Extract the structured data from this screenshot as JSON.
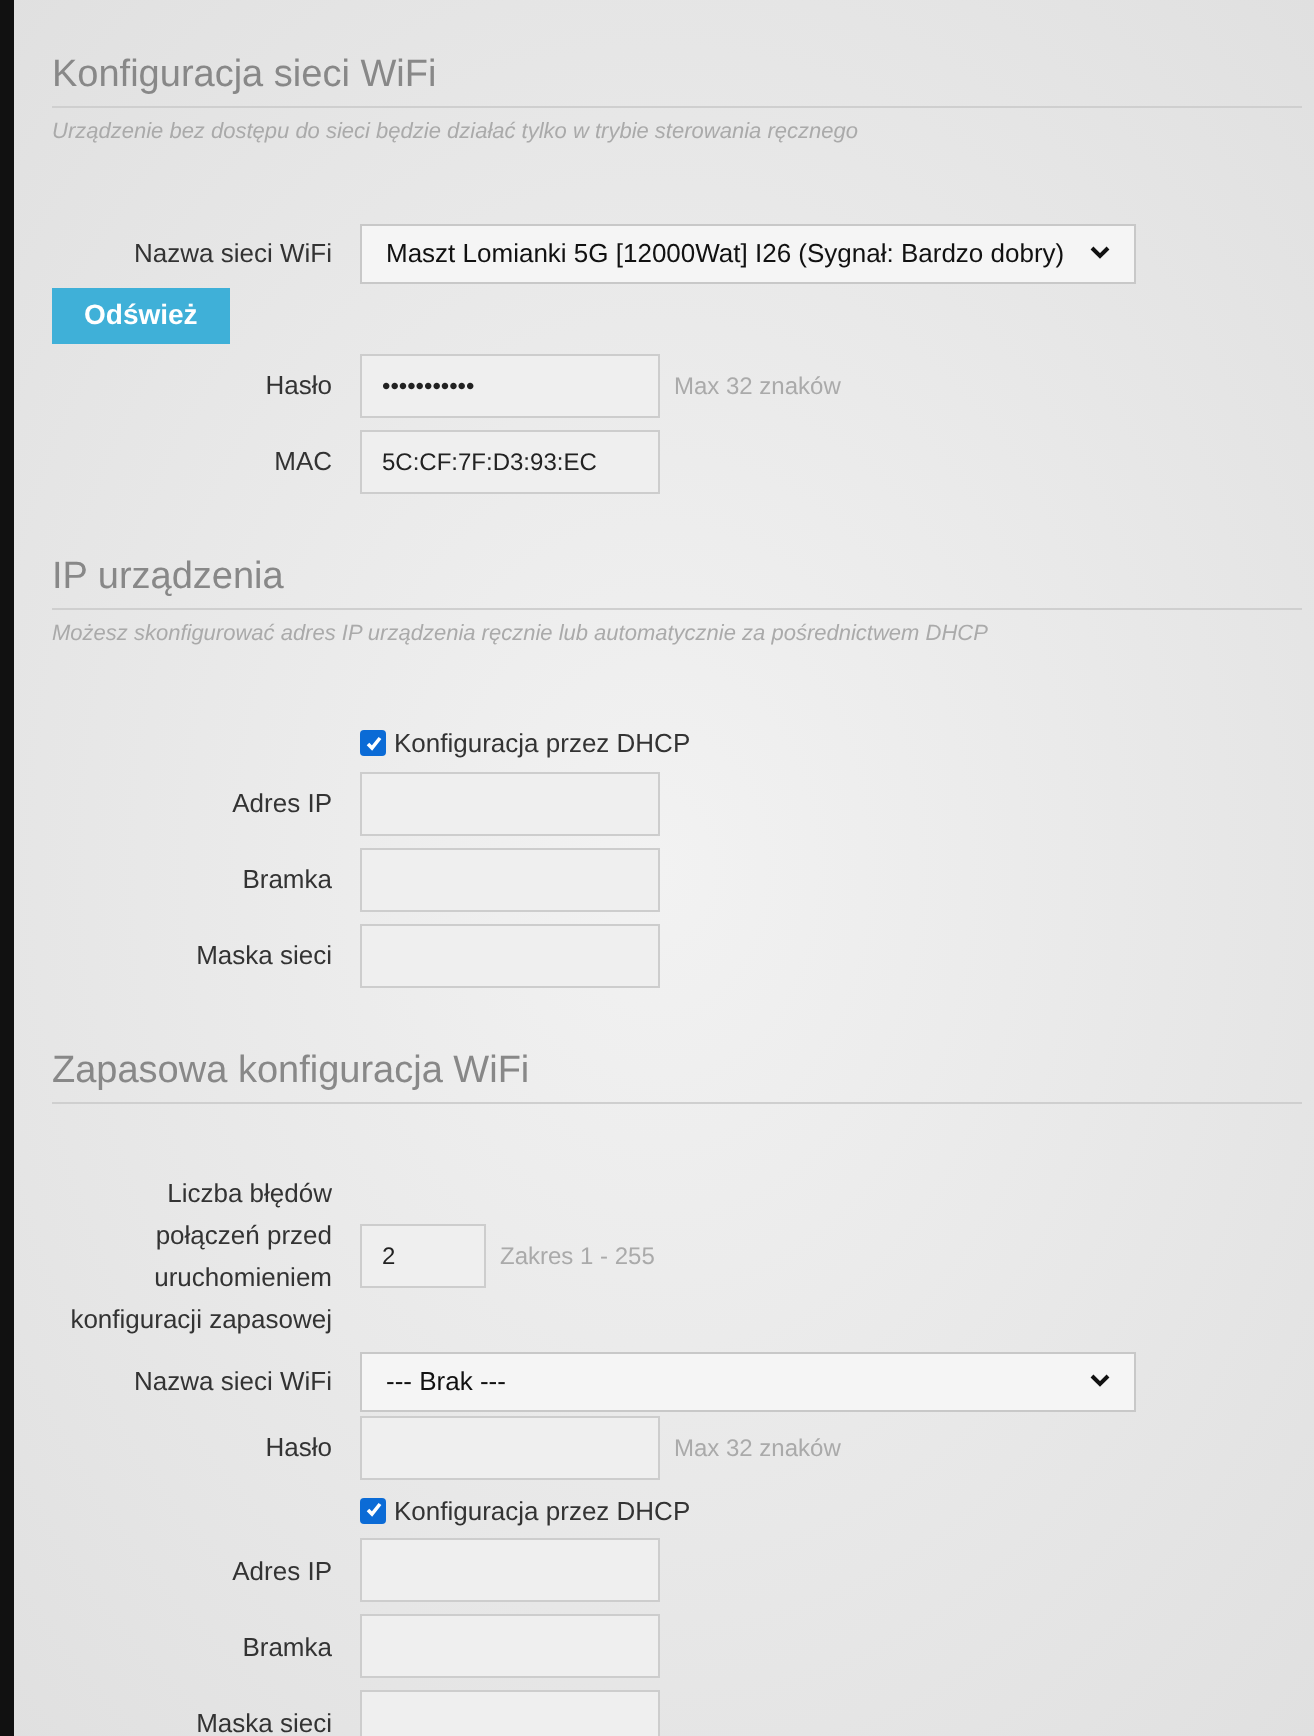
{
  "sections": [
    {
      "title": "Konfiguracja sieci WiFi",
      "subtitle": "Urządzenie bez dostępu do sieci będzie działać tylko w trybie sterowania ręcznego",
      "rows": [
        {
          "kind": "select",
          "label": "Nazwa sieci WiFi",
          "value": "Maszt Lomianki 5G [12000Wat] I26 (Sygnał: Bardzo dobry)"
        },
        {
          "kind": "button",
          "label": "Odśwież"
        },
        {
          "kind": "input",
          "label": "Hasło",
          "value": "•••••••••••",
          "hint": "Max 32 znaków"
        },
        {
          "kind": "input",
          "label": "MAC",
          "value": "5C:CF:7F:D3:93:EC"
        }
      ]
    },
    {
      "title": "IP urządzenia",
      "subtitle": "Możesz skonfigurować adres IP urządzenia ręcznie lub automatycznie za pośrednictwem DHCP",
      "rows": [
        {
          "kind": "checkbox",
          "label": "Konfiguracja przez DHCP",
          "checked": true
        },
        {
          "kind": "input",
          "label": "Adres IP"
        },
        {
          "kind": "input",
          "label": "Bramka"
        },
        {
          "kind": "input",
          "label": "Maska sieci"
        }
      ]
    },
    {
      "title": "Zapasowa konfiguracja WiFi",
      "rows": [
        {
          "kind": "number",
          "label": "Liczba błędów połączeń przed uruchomieniem konfiguracji zapasowej",
          "value": "2",
          "hint": "Zakres 1 - 255"
        },
        {
          "kind": "select",
          "label": "Nazwa sieci WiFi",
          "value": "--- Brak ---"
        },
        {
          "kind": "input",
          "label": "Hasło",
          "hint": "Max 32 znaków"
        },
        {
          "kind": "checkbox",
          "label": "Konfiguracja przez DHCP",
          "checked": true
        },
        {
          "kind": "input",
          "label": "Adres IP"
        },
        {
          "kind": "input",
          "label": "Bramka"
        },
        {
          "kind": "input",
          "label": "Maska sieci"
        }
      ]
    }
  ]
}
